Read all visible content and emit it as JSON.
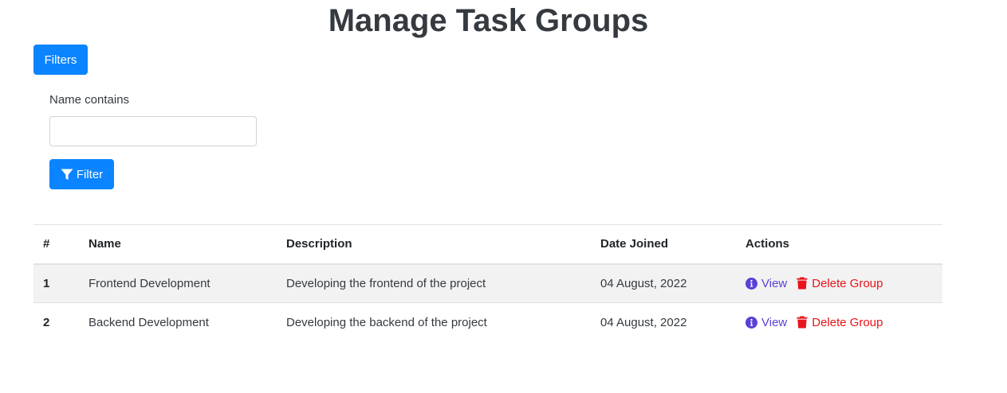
{
  "page": {
    "title": "Manage Task Groups"
  },
  "filters": {
    "toggle_label": "Filters",
    "name_label": "Name contains",
    "name_value": "",
    "name_placeholder": "",
    "submit_label": "Filter",
    "submit_icon": "filter-icon"
  },
  "table": {
    "headers": {
      "num": "#",
      "name": "Name",
      "description": "Description",
      "date": "Date Joined",
      "actions": "Actions"
    },
    "rows": [
      {
        "num": "1",
        "name": "Frontend Development",
        "description": "Developing the frontend of the project",
        "date": "04 August, 2022",
        "view_label": "View",
        "delete_label": "Delete Group"
      },
      {
        "num": "2",
        "name": "Backend Development",
        "description": "Developing the backend of the project",
        "date": "04 August, 2022",
        "view_label": "View",
        "delete_label": "Delete Group"
      }
    ]
  },
  "colors": {
    "primary": "#0b84ff",
    "view": "#5b3fd6",
    "delete": "#e8141b",
    "stripe": "#f2f2f2"
  },
  "icons": {
    "view": "info-circle-icon",
    "delete": "trash-icon"
  }
}
